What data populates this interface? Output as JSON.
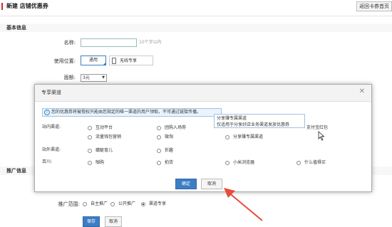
{
  "header": {
    "title": "新建 店铺优惠券",
    "back_label": "返回卡券首页",
    "accent": "#c9302c"
  },
  "basic_info": {
    "section_label": "基本信息",
    "name_label": "名称:",
    "name_value": "",
    "name_hint": "10个字以内",
    "position_label": "使用位置:",
    "position_options": [
      "通用",
      "无线专享"
    ],
    "denomination_label": "面额:",
    "denomination_value": "3元"
  },
  "promotion": {
    "section_label": "推广信息",
    "range_label": "推广范围:",
    "range_options": [
      "自主推广",
      "公开推广",
      "渠道专享"
    ],
    "selected_range": "渠道专享",
    "save_label": "保存",
    "cancel_label": "取消"
  },
  "dialog": {
    "title": "专享渠道",
    "notice_icon": "info-icon",
    "notice": "您的优惠券将被授权只能由您指定的唯一渠道的用户领取，不可通过链接传播。",
    "tooltip_line1": "分享赚专属渠道",
    "tooltip_line2": "仅适用于分享好店业务渠道发放优惠券",
    "rows": [
      {
        "label": "站内渠道:",
        "options": [
          "互动平台",
          "团购入场券",
          "分享赚专属渠道",
          "支付宝红包"
        ]
      },
      {
        "label": "",
        "options": [
          "流量钱包营销",
          "微淘"
        ]
      },
      {
        "label": "站外渠道:",
        "options": [
          "蜻蜓育儿",
          "折趣"
        ]
      },
      {
        "label": "百川:",
        "options": [
          "咖购",
          "拍货",
          "小米浏览器",
          "什么值得买"
        ]
      }
    ],
    "confirm_label": "确定",
    "cancel_label": "取消",
    "primary_color": "#3c7dc4"
  },
  "annotation_color": "#e74c3c"
}
